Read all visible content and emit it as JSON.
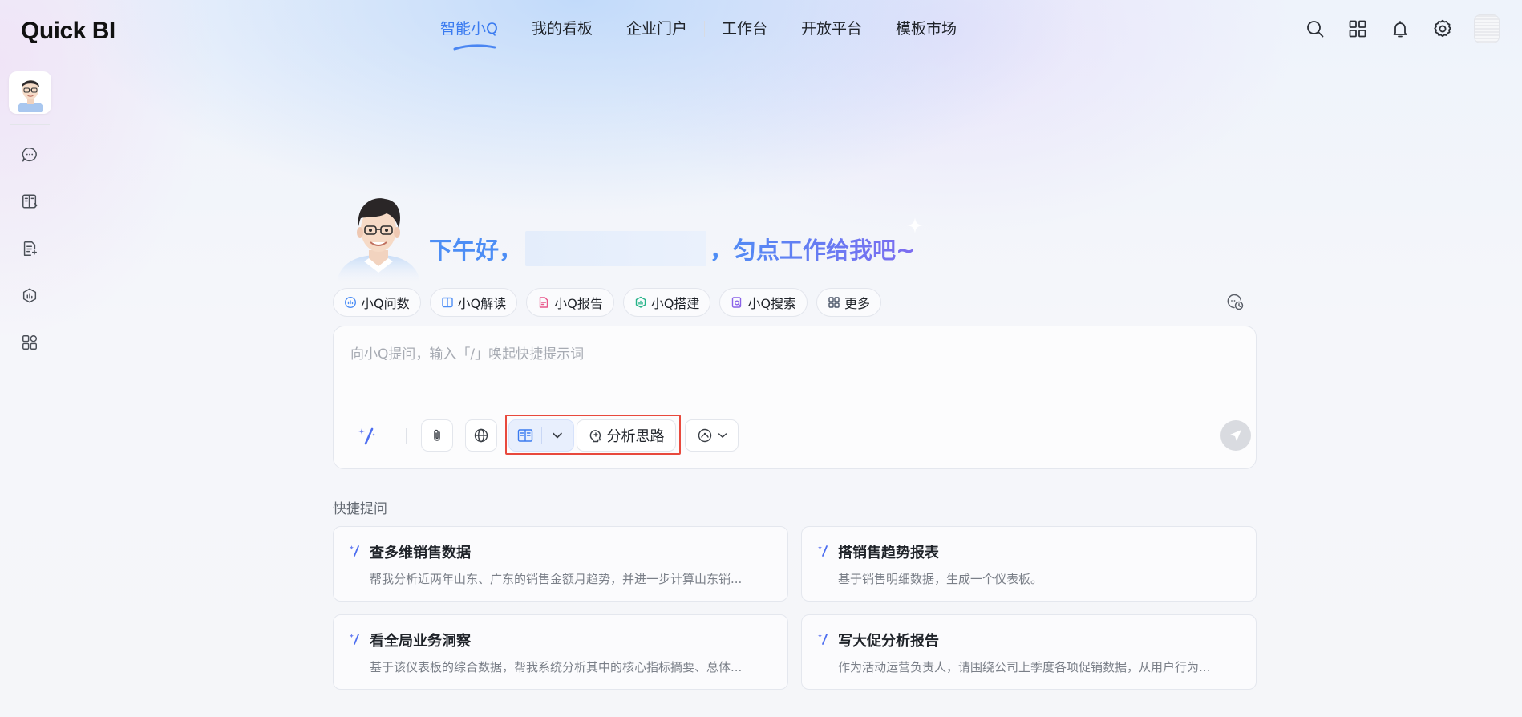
{
  "app": {
    "logo": "Quick BI"
  },
  "nav": {
    "items": [
      {
        "label": "智能小Q",
        "active": true
      },
      {
        "label": "我的看板",
        "active": false
      },
      {
        "label": "企业门户",
        "active": false
      },
      {
        "label": "工作台",
        "active": false
      },
      {
        "label": "开放平台",
        "active": false
      },
      {
        "label": "模板市场",
        "active": false
      }
    ],
    "right_icons": [
      "search-icon",
      "apps-grid-icon",
      "bell-icon",
      "gear-icon",
      "avatar"
    ]
  },
  "sidebar": {
    "icons": [
      "chat-bubble-icon",
      "book-open-icon",
      "report-doc-icon",
      "ai-chip-icon",
      "apps-icon"
    ]
  },
  "hero": {
    "greeting_prefix": "下午好，",
    "greeting_suffix": "，匀点工作给我吧~"
  },
  "chips": [
    {
      "label": "小Q问数",
      "icon": "chat-data-icon",
      "color": "#4d8ef5"
    },
    {
      "label": "小Q解读",
      "icon": "book-icon",
      "color": "#4d8ef5"
    },
    {
      "label": "小Q报告",
      "icon": "doc-icon",
      "color": "#e8578b"
    },
    {
      "label": "小Q搭建",
      "icon": "build-icon",
      "color": "#25b388"
    },
    {
      "label": "小Q搜索",
      "icon": "search-doc-icon",
      "color": "#8a63e8"
    },
    {
      "label": "更多",
      "icon": "grid-icon",
      "color": "#4a5568"
    }
  ],
  "input": {
    "placeholder": "向小Q提问，输入「/」唤起快捷提示词",
    "think_label": "分析思路"
  },
  "quick": {
    "title": "快捷提问",
    "cards": [
      {
        "title": "查多维销售数据",
        "desc": "帮我分析近两年山东、广东的销售金额月趋势，并进一步计算山东销..."
      },
      {
        "title": "搭销售趋势报表",
        "desc": "基于销售明细数据，生成一个仪表板。"
      },
      {
        "title": "看全局业务洞察",
        "desc": "基于该仪表板的综合数据，帮我系统分析其中的核心指标摘要、总体..."
      },
      {
        "title": "写大促分析报告",
        "desc": "作为活动运营负责人，请围绕公司上季度各项促销数据，从用户行为..."
      }
    ]
  },
  "colors": {
    "accent": "#3a7bf0",
    "highlight_border": "#e8493d"
  }
}
